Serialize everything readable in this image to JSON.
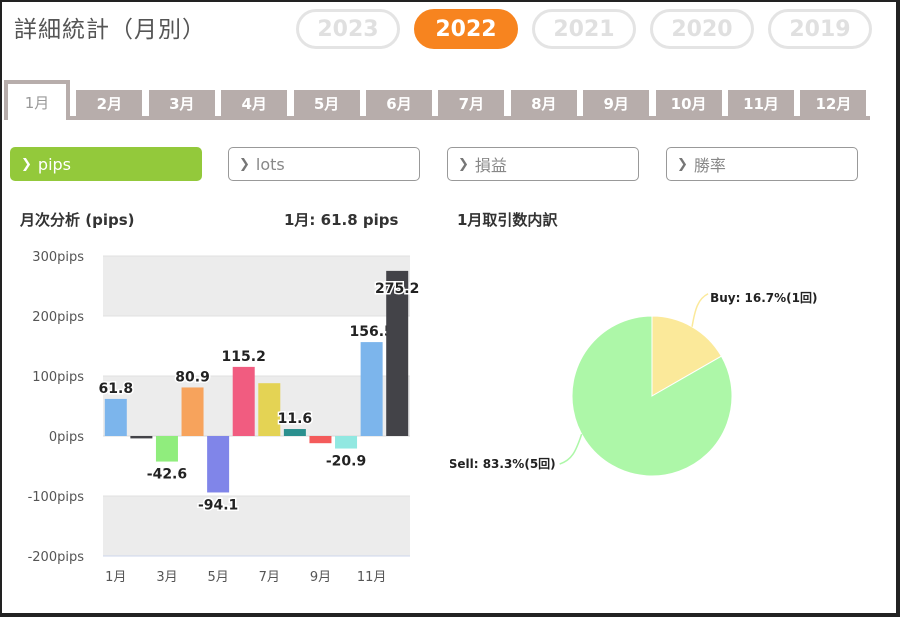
{
  "page_title": "詳細統計（月別）",
  "years": [
    {
      "label": "2023",
      "active": false
    },
    {
      "label": "2022",
      "active": true
    },
    {
      "label": "2021",
      "active": false
    },
    {
      "label": "2020",
      "active": false
    },
    {
      "label": "2019",
      "active": false
    }
  ],
  "months": [
    {
      "label": "1月",
      "active": true
    },
    {
      "label": "2月",
      "active": false
    },
    {
      "label": "3月",
      "active": false
    },
    {
      "label": "4月",
      "active": false
    },
    {
      "label": "5月",
      "active": false
    },
    {
      "label": "6月",
      "active": false
    },
    {
      "label": "7月",
      "active": false
    },
    {
      "label": "8月",
      "active": false
    },
    {
      "label": "9月",
      "active": false
    },
    {
      "label": "10月",
      "active": false
    },
    {
      "label": "11月",
      "active": false
    },
    {
      "label": "12月",
      "active": false
    }
  ],
  "metrics": [
    {
      "label": "pips",
      "active": true
    },
    {
      "label": "lots",
      "active": false
    },
    {
      "label": "損益",
      "active": false
    },
    {
      "label": "勝率",
      "active": false
    }
  ],
  "monthly_analysis": {
    "title": "月次分析 (pips)",
    "summary": "1月:  61.8 pips"
  },
  "breakdown": {
    "title": "1月取引数内訳"
  },
  "colors": {
    "accent_orange": "#f7841f",
    "accent_green": "#93c93b",
    "tab_gray": "#b7adab",
    "pie_buy": "#fbe99a",
    "pie_sell": "#adf7a8"
  },
  "chart_data": [
    {
      "type": "bar",
      "title": "月次分析 (pips)",
      "categories": [
        "1月",
        "2月",
        "3月",
        "4月",
        "5月",
        "6月",
        "7月",
        "8月",
        "9月",
        "10月",
        "11月",
        "12月"
      ],
      "values": [
        61.8,
        -4,
        -42.6,
        80.9,
        -94.1,
        115.2,
        88,
        11.6,
        -12,
        -20.9,
        156.5,
        275.2
      ],
      "data_labels": [
        "61.8",
        "",
        "-42.6",
        "80.9",
        "-94.1",
        "115.2",
        "",
        "11.6",
        "",
        "-20.9",
        "156.5",
        "275.2"
      ],
      "bar_colors": [
        "#7cb5ec",
        "#434348",
        "#90ed7d",
        "#f7a35c",
        "#8085e9",
        "#f15c80",
        "#e4d354",
        "#2b908f",
        "#f45b5b",
        "#91e8e1",
        "#7cb5ec",
        "#434348"
      ],
      "y_ticks": [
        "300pips",
        "200pips",
        "100pips",
        "0pips",
        "-100pips",
        "-200pips"
      ],
      "x_tick_labels": [
        "1月",
        "3月",
        "5月",
        "7月",
        "9月",
        "11月"
      ],
      "ylim": [
        -200,
        300
      ],
      "grid": true
    },
    {
      "type": "pie",
      "title": "1月取引数内訳",
      "slices": [
        {
          "name": "Buy",
          "value": 16.7,
          "label": "Buy: 16.7%(1回)",
          "color": "#fbe99a"
        },
        {
          "name": "Sell",
          "value": 83.3,
          "label": "Sell: 83.3%(5回)",
          "color": "#adf7a8"
        }
      ]
    }
  ]
}
